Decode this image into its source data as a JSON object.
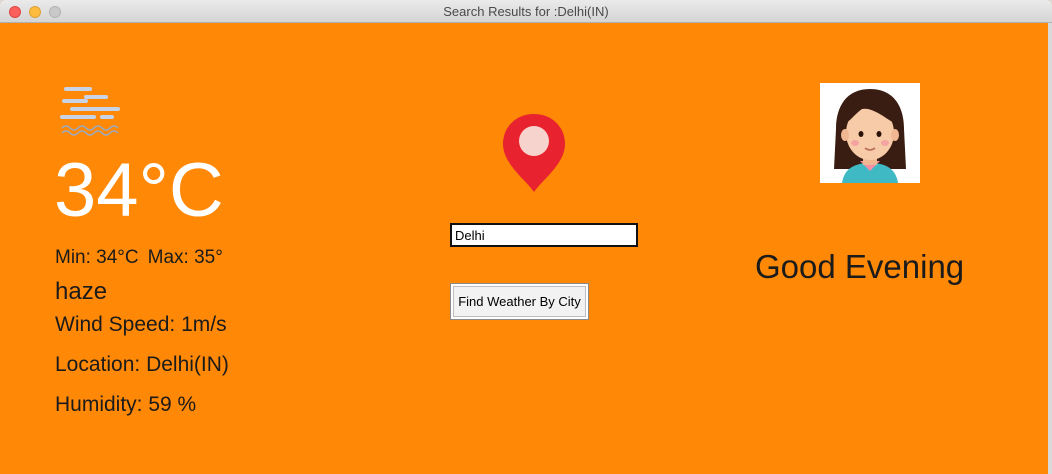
{
  "window": {
    "title": "Search Results for :Delhi(IN)"
  },
  "weather": {
    "icon": "haze-icon",
    "temperature": "34°C",
    "min": "Min: 34°C",
    "max": "Max: 35°",
    "description": "haze",
    "wind_speed": "Wind Speed: 1m/s",
    "location": "Location: Delhi(IN)",
    "humidity": "Humidity: 59 %"
  },
  "search": {
    "icon": "map-pin-icon",
    "city_value": "Delhi",
    "button_label": "Find Weather By City"
  },
  "greeting": {
    "avatar": "girl-avatar",
    "text": "Good Evening"
  },
  "colors": {
    "background": "#ff8806",
    "pin": "#e8232f",
    "temperature_text": "#ffffff"
  }
}
